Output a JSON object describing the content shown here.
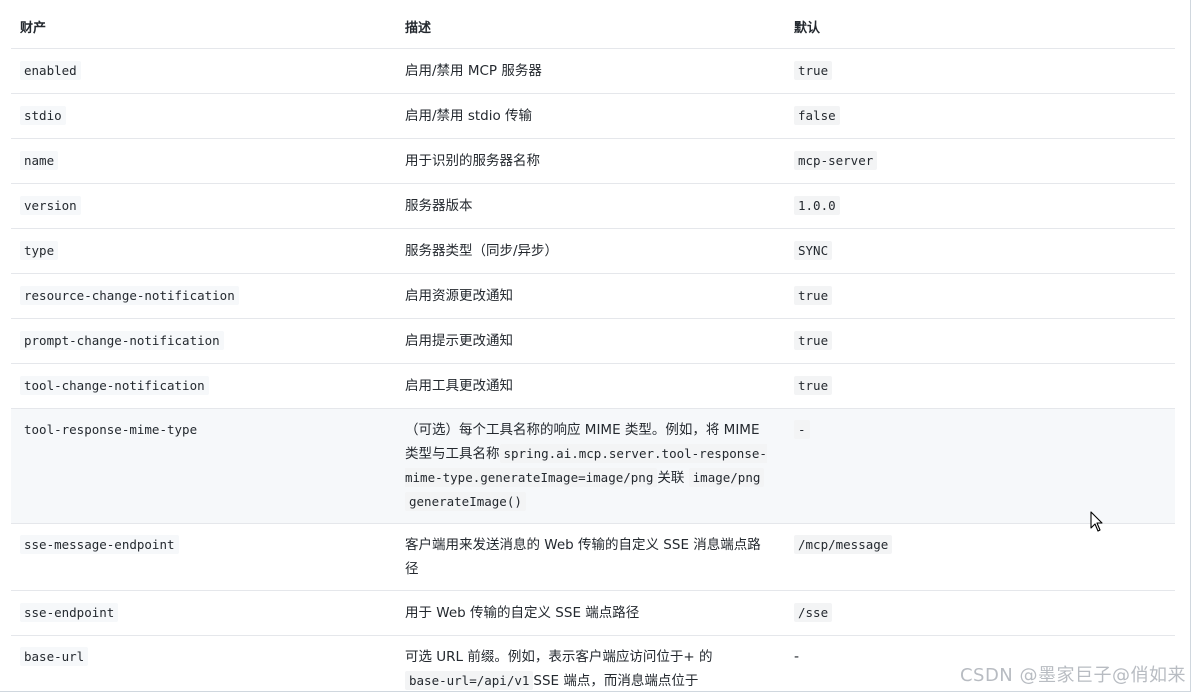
{
  "table": {
    "headers": {
      "property": "财产",
      "description": "描述",
      "default": "默认"
    },
    "rows": [
      {
        "key": "enabled",
        "desc": "启用/禁用 MCP 服务器",
        "default": "true"
      },
      {
        "key": "stdio",
        "desc": "启用/禁用 stdio 传输",
        "default": "false"
      },
      {
        "key": "name",
        "desc": "用于识别的服务器名称",
        "default": "mcp-server"
      },
      {
        "key": "version",
        "desc": "服务器版本",
        "default": "1.0.0"
      },
      {
        "key": "type",
        "desc": "服务器类型（同步/异步）",
        "default": "SYNC"
      },
      {
        "key": "resource-change-notification",
        "desc": "启用资源更改通知",
        "default": "true"
      },
      {
        "key": "prompt-change-notification",
        "desc": "启用提示更改通知",
        "default": "true"
      },
      {
        "key": "tool-change-notification",
        "desc": "启用工具更改通知",
        "default": "true"
      },
      {
        "key": "tool-response-mime-type",
        "desc_parts": {
          "t1": "（可选）每个工具名称的响应 MIME 类型。例如，将 MIME 类型与工具名称",
          "c1": "spring.ai.mcp.server.tool-response-mime-type.generateImage=image/png",
          "t2": "关联",
          "c2": "image/png",
          "c3": "generateImage()"
        },
        "default": "-"
      },
      {
        "key": "sse-message-endpoint",
        "desc": "客户端用来发送消息的 Web 传输的自定义 SSE 消息端点路径",
        "default": "/mcp/message"
      },
      {
        "key": "sse-endpoint",
        "desc": "用于 Web 传输的自定义 SSE 端点路径",
        "default": "/sse"
      },
      {
        "key": "base-url",
        "desc_parts": {
          "t1": "可选 URL 前缀。例如，表示客户端应访问位于+ 的",
          "c1": "base-url=/api/v1",
          "t2": "SSE 端点，而消息端点位于"
        },
        "default": "-"
      }
    ]
  },
  "watermark": "CSDN @墨家巨子@俏如来",
  "cursor_icon": "mouse-pointer-icon"
}
